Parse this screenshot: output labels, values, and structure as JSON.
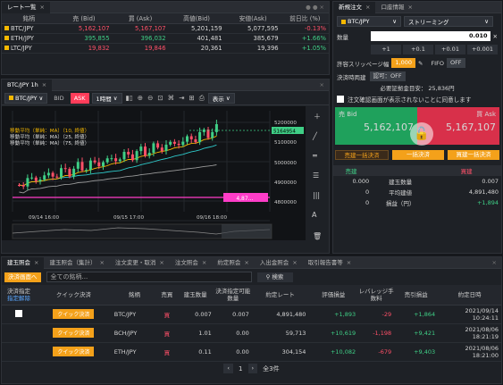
{
  "rate_panel": {
    "tab": "レート一覧",
    "headers": [
      "銘柄",
      "売 (Bid)",
      "買 (Ask)",
      "高値(Bid)",
      "安値(Ask)",
      "前日比 (%)"
    ],
    "rows": [
      {
        "sym": "BTC/JPY",
        "bid": "5,162,107",
        "ask": "5,167,107",
        "high": "5,201,159",
        "low": "5,077,595",
        "chg": "-0.13%",
        "dir": "dn"
      },
      {
        "sym": "ETH/JPY",
        "bid": "395,855",
        "ask": "396,032",
        "high": "401,481",
        "low": "385,679",
        "chg": "+1.66%",
        "dir": "up"
      },
      {
        "sym": "LTC/JPY",
        "bid": "19,832",
        "ask": "19,846",
        "high": "20,361",
        "low": "19,396",
        "chg": "+1.05%",
        "dir": "up"
      }
    ]
  },
  "chart_panel": {
    "tab": "BTC/JPY 1h",
    "symbol": "BTC/JPY",
    "bid": "BID",
    "ask": "ASK",
    "interval": "1時間",
    "display": "表示",
    "legend": [
      "移動平均（単純：MA）（10, 終値）",
      "移動平均（単純：MA）（25, 終値）",
      "移動平均（単純：MA）（75, 終値）"
    ],
    "price_ticks": [
      "5200000",
      "5100000",
      "5000000",
      "4900000",
      "4800000"
    ],
    "current_price": "5164954",
    "marker_price": "4,87…",
    "xlabels": [
      "09/14 16:00",
      "09/15 17:00",
      "09/16 18:00"
    ],
    "marker_label": "09/16 18:00"
  },
  "order_panel": {
    "tabs": [
      "新規注文",
      "口座情報"
    ],
    "symbol": "BTC/JPY",
    "mode": "ストリーミング",
    "qty_label": "数量",
    "qty": "0.010",
    "steps": [
      "+1",
      "+0.1",
      "+0.01",
      "+0.001"
    ],
    "slip_label": "許容スリッページ幅",
    "slip": "1,000",
    "fifo": "FIFO",
    "fifo_state": "OFF",
    "settle_label": "決済時両建",
    "settle_state": "認可：OFF",
    "margin_text": "必要証拠金目安： 25,836円",
    "confirm_text": "注文確認画面が表示されないことに同意します",
    "bid_label": "売 Bid",
    "bid": "5,162,107",
    "ask_label": "買 Ask",
    "ask": "5,167,107",
    "b1": "売建一括決済",
    "b2": "一括決済",
    "b3": "買建一括決済",
    "sell_head": "売建",
    "buy_head": "買建",
    "pos": [
      {
        "l": "0.000",
        "m": "建玉数量",
        "r": "0.007"
      },
      {
        "l": "0",
        "m": "平均建値",
        "r": "4,891,480"
      },
      {
        "l": "0",
        "m": "損益（円）",
        "r": "+1,894"
      }
    ]
  },
  "bottom": {
    "tabs": [
      "建玉照会",
      "建玉照会（集計）",
      "注文変更・取消",
      "注文照会",
      "約定照会",
      "入出金照会",
      "取引報告書等"
    ],
    "settle_btn": "決済画面へ",
    "filter": "全ての銘柄...",
    "search": "検索",
    "headers": [
      "決済指定",
      "クイック決済",
      "銘柄",
      "売買",
      "建玉数量",
      "決済指定可能数量",
      "約定レート",
      "評価損益",
      "レバレッジ手数料",
      "売引損益",
      "約定日時"
    ],
    "subhead": "指定解除",
    "rows": [
      {
        "check": true,
        "q": "クイック決済",
        "sym": "BTC/JPY",
        "side": "買",
        "qty": "0.007",
        "avail": "0.007",
        "rate": "4,891,480",
        "pl": "+1,893",
        "lev": "-29",
        "net": "+1,864",
        "date": "2021/09/14",
        "time": "10:24:11"
      },
      {
        "check": false,
        "q": "クイック決済",
        "sym": "BCH/JPY",
        "side": "買",
        "qty": "1.01",
        "avail": "0.00",
        "rate": "59,713",
        "pl": "+10,619",
        "lev": "-1,198",
        "net": "+9,421",
        "date": "2021/08/06",
        "time": "18:21:19"
      },
      {
        "check": false,
        "q": "クイック決済",
        "sym": "ETH/JPY",
        "side": "買",
        "qty": "0.11",
        "avail": "0.00",
        "rate": "304,154",
        "pl": "+10,082",
        "lev": "-679",
        "net": "+9,403",
        "date": "2021/08/06",
        "time": "18:21:00"
      }
    ],
    "page": "1",
    "total": "全3件"
  }
}
